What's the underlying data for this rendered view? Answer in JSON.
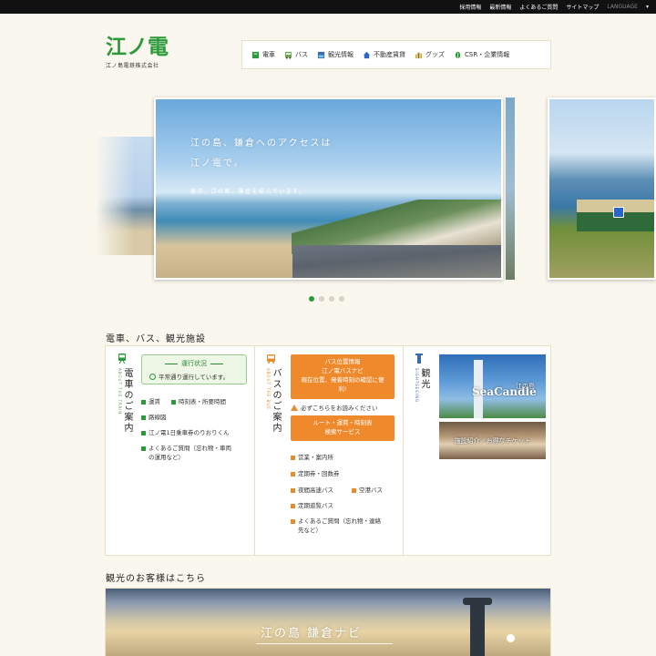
{
  "topbar": {
    "links": [
      "採用情報",
      "最新情報",
      "よくあるご質問",
      "サイトマップ"
    ],
    "language": "LANGUAGE"
  },
  "logo": {
    "mark": "江ノ電",
    "company": "江ノ島電鉄株式会社"
  },
  "nav": [
    {
      "label": "電車",
      "icon": "train-logo-icon",
      "color": "#2c9a3a"
    },
    {
      "label": "バス",
      "icon": "bus-icon",
      "color": "#6aa84f"
    },
    {
      "label": "観光情報",
      "icon": "sightseeing-icon",
      "color": "#3a6ab0"
    },
    {
      "label": "不動産賃貸",
      "icon": "house-icon",
      "color": "#2a66c8"
    },
    {
      "label": "グッズ",
      "icon": "goods-icon",
      "color": "#c8b428"
    },
    {
      "label": "CSR・企業情報",
      "icon": "leaf-icon",
      "color": "#2c9a3a"
    }
  ],
  "hero": {
    "headline1": "江の島、鎌倉へのアクセスは",
    "headline2": "江ノ電で。",
    "sub": "藤沢、江の島、鎌倉を結んでいます。",
    "slide_count": 4,
    "active_slide": 1
  },
  "section1": {
    "title": "電車、バス、観光施設"
  },
  "train": {
    "heading": "電車のご案内",
    "heading_en": "ABOUT THE TRAIN",
    "status_title": "運行状況",
    "status_msg": "平常通り運行しています。",
    "links": [
      "運賃",
      "時刻表・所要時間",
      "路線図",
      "江ノ電1日乗車券のりおりくん",
      "よくあるご質問（忘れ物・車両",
      "の運用など）"
    ]
  },
  "bus": {
    "heading": "バスのご案内",
    "heading_en": "ABOUT THE BUS",
    "btn1_line1": "バス位置情報",
    "btn1_line2": "江ノ電バスナビ",
    "btn1_line3": "現在位置、発着時刻の確認に便",
    "btn1_line4": "利!",
    "warning": "必ずこちらをお読みください",
    "btn2_line1": "ルート・運賃・時刻表",
    "btn2_line2": "検索サービス",
    "links": [
      "営業・案内所",
      "定期券・回数券",
      "夜間高速バス",
      "空港バス",
      "定期遊覧バス",
      "よくあるご質問（忘れ物・連絡",
      "先など）"
    ]
  },
  "tourism": {
    "heading": "観光",
    "heading_en": "SIGHTSEEING",
    "photo1_logo": "SeaCandle",
    "photo1_jp": "江の島",
    "photo2_caption": "施設紹介／お得なチケット"
  },
  "section2": {
    "title": "観光のお客様はこちら"
  },
  "banner": {
    "title": "江の島 鎌倉ナビ"
  }
}
